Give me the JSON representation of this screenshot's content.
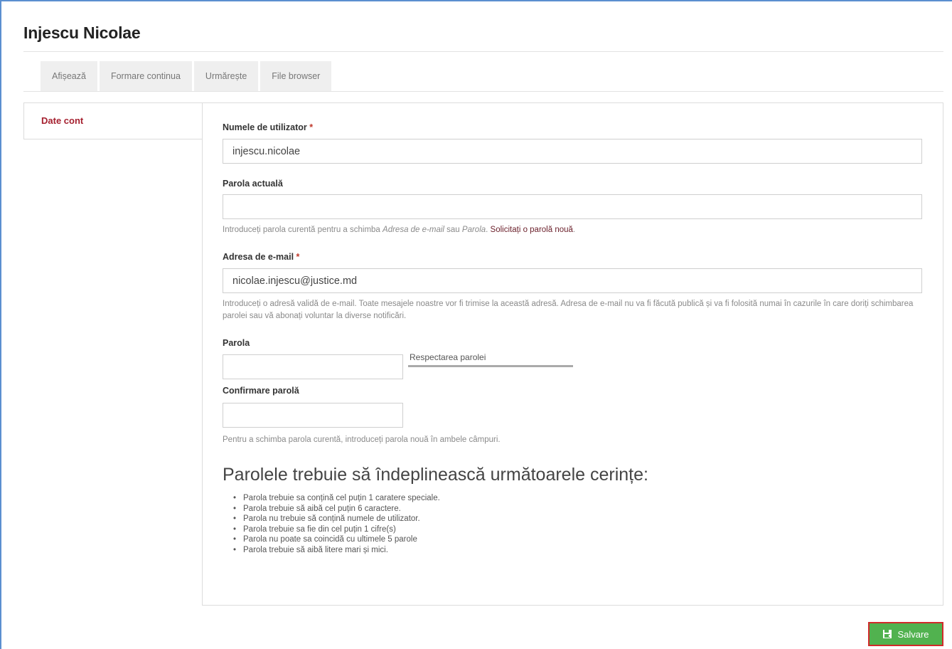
{
  "page": {
    "title": "Injescu Nicolae"
  },
  "tabs": [
    {
      "label": "Afișează"
    },
    {
      "label": "Formare continua"
    },
    {
      "label": "Urmărește"
    },
    {
      "label": "File browser"
    }
  ],
  "vertical_tabs": [
    {
      "label": "Date cont"
    }
  ],
  "form": {
    "username": {
      "label": "Numele de utilizator",
      "value": "injescu.nicolae"
    },
    "current_password": {
      "label": "Parola actuală",
      "value": "",
      "help_prefix": "Introduceți parola curentă pentru a schimba ",
      "help_em1": "Adresa de e-mail",
      "help_mid": " sau ",
      "help_em2": "Parola",
      "help_suffix": ". ",
      "help_link": "Solicitați o parolă nouă",
      "help_end": "."
    },
    "email": {
      "label": "Adresa de e-mail",
      "value": "nicolae.injescu@justice.md",
      "help": "Introduceți o adresă validă de e-mail. Toate mesajele noastre vor fi trimise la această adresă. Adresa de e-mail nu va fi făcută publică și va fi folosită numai în cazurile în care doriți schimbarea parolei sau vă abonați voluntar la diverse notificări."
    },
    "password": {
      "label": "Parola",
      "value": "",
      "strength_label": "Respectarea parolei"
    },
    "confirm_password": {
      "label": "Confirmare parolă",
      "value": "",
      "help": "Pentru a schimba parola curentă, introduceți parola nouă în ambele câmpuri."
    },
    "required_marker": "*"
  },
  "requirements": {
    "title": "Parolele trebuie să îndeplinească următoarele cerințe:",
    "items": [
      "Parola trebuie sa conțină cel puțin 1 caratere speciale.",
      "Parola trebuie să aibă cel puțin 6 caractere.",
      "Parola nu trebuie să conțină numele de utilizator.",
      "Parola trebuie sa fie din cel puțin 1 cifre(s)",
      "Parola nu poate sa coincidă cu ultimele 5 parole",
      "Parola trebuie să aibă litere mari și mici."
    ]
  },
  "actions": {
    "save_label": "Salvare",
    "save_icon": "save-icon"
  },
  "colors": {
    "accent": "#a5202f",
    "save": "#51b24f",
    "save_border": "#d12a2a",
    "frame": "#5b8fd0"
  }
}
